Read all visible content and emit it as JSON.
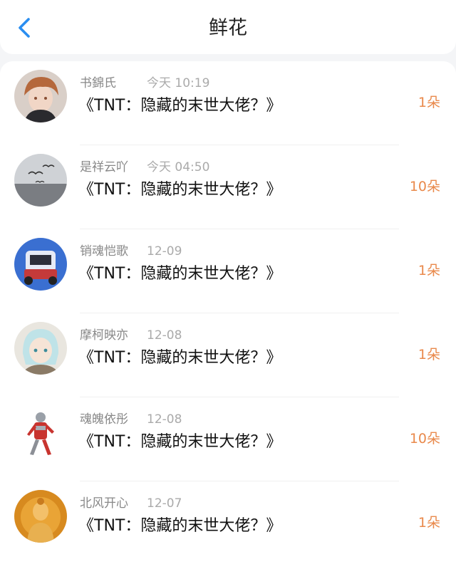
{
  "header": {
    "title": "鲜花",
    "back_icon": "chevron-left-icon",
    "accent_color": "#2a8ef0"
  },
  "count_color": "#e9894b",
  "items": [
    {
      "name": "书錦氏",
      "time": "今天 10:19",
      "book": "《TNT：隐藏的末世大佬？》",
      "count": "1朵",
      "avatar": "anime-boy-avatar"
    },
    {
      "name": "是祥云吖",
      "time": "今天 04:50",
      "book": "《TNT：隐藏的末世大佬？》",
      "count": "10朵",
      "avatar": "birds-sky-avatar"
    },
    {
      "name": "销魂恺歌",
      "time": "12-09",
      "book": "《TNT：隐藏的末世大佬？》",
      "count": "1朵",
      "avatar": "toy-car-avatar"
    },
    {
      "name": "摩柯映亦",
      "time": "12-08",
      "book": "《TNT：隐藏的末世大佬？》",
      "count": "1朵",
      "avatar": "anime-girl-avatar"
    },
    {
      "name": "魂魄依彤",
      "time": "12-08",
      "book": "《TNT：隐藏的末世大佬？》",
      "count": "10朵",
      "avatar": "hero-figure-avatar"
    },
    {
      "name": "北风开心",
      "time": "12-07",
      "book": "《TNT：隐藏的末世大佬？》",
      "count": "1朵",
      "avatar": "buddha-statue-avatar"
    }
  ]
}
